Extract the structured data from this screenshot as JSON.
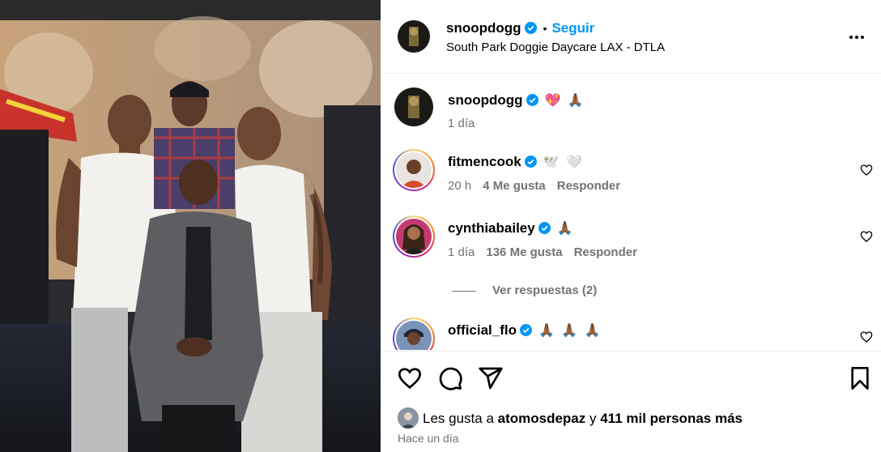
{
  "post": {
    "photo_alt": "group photo",
    "author": {
      "username": "snoopdogg",
      "follow_label": "Seguir",
      "separator": "•",
      "location": "South Park Doggie Daycare LAX - DTLA"
    },
    "caption": {
      "username": "snoopdogg",
      "text": "💖 🙏🏾",
      "time": "1 día"
    },
    "comments": [
      {
        "username": "fitmencook",
        "text": "🕊️ 🤍",
        "time": "20 h",
        "likes": "4 Me gusta",
        "reply": "Responder"
      },
      {
        "username": "cynthiabailey",
        "text": "🙏🏾",
        "time": "1 día",
        "likes": "136 Me gusta",
        "reply": "Responder"
      },
      {
        "username": "official_flo",
        "text": "🙏🏾 🙏🏾 🙏🏾",
        "time": "",
        "likes": "",
        "reply": ""
      }
    ],
    "view_replies": "Ver respuestas (2)",
    "likes_summary": {
      "prefix": "Les gusta a ",
      "user": "atomosdepaz",
      "middle": " y ",
      "count": "411 mil personas más"
    },
    "posted": "Hace un día"
  },
  "colors": {
    "accent": "#0095f6",
    "secondary_text": "#737373",
    "divider": "#efefef"
  },
  "icons": {
    "more": "more-horizontal-icon",
    "like": "heart-icon",
    "comment": "comment-icon",
    "share": "share-icon",
    "save": "bookmark-icon",
    "verified": "verified-badge-icon"
  }
}
